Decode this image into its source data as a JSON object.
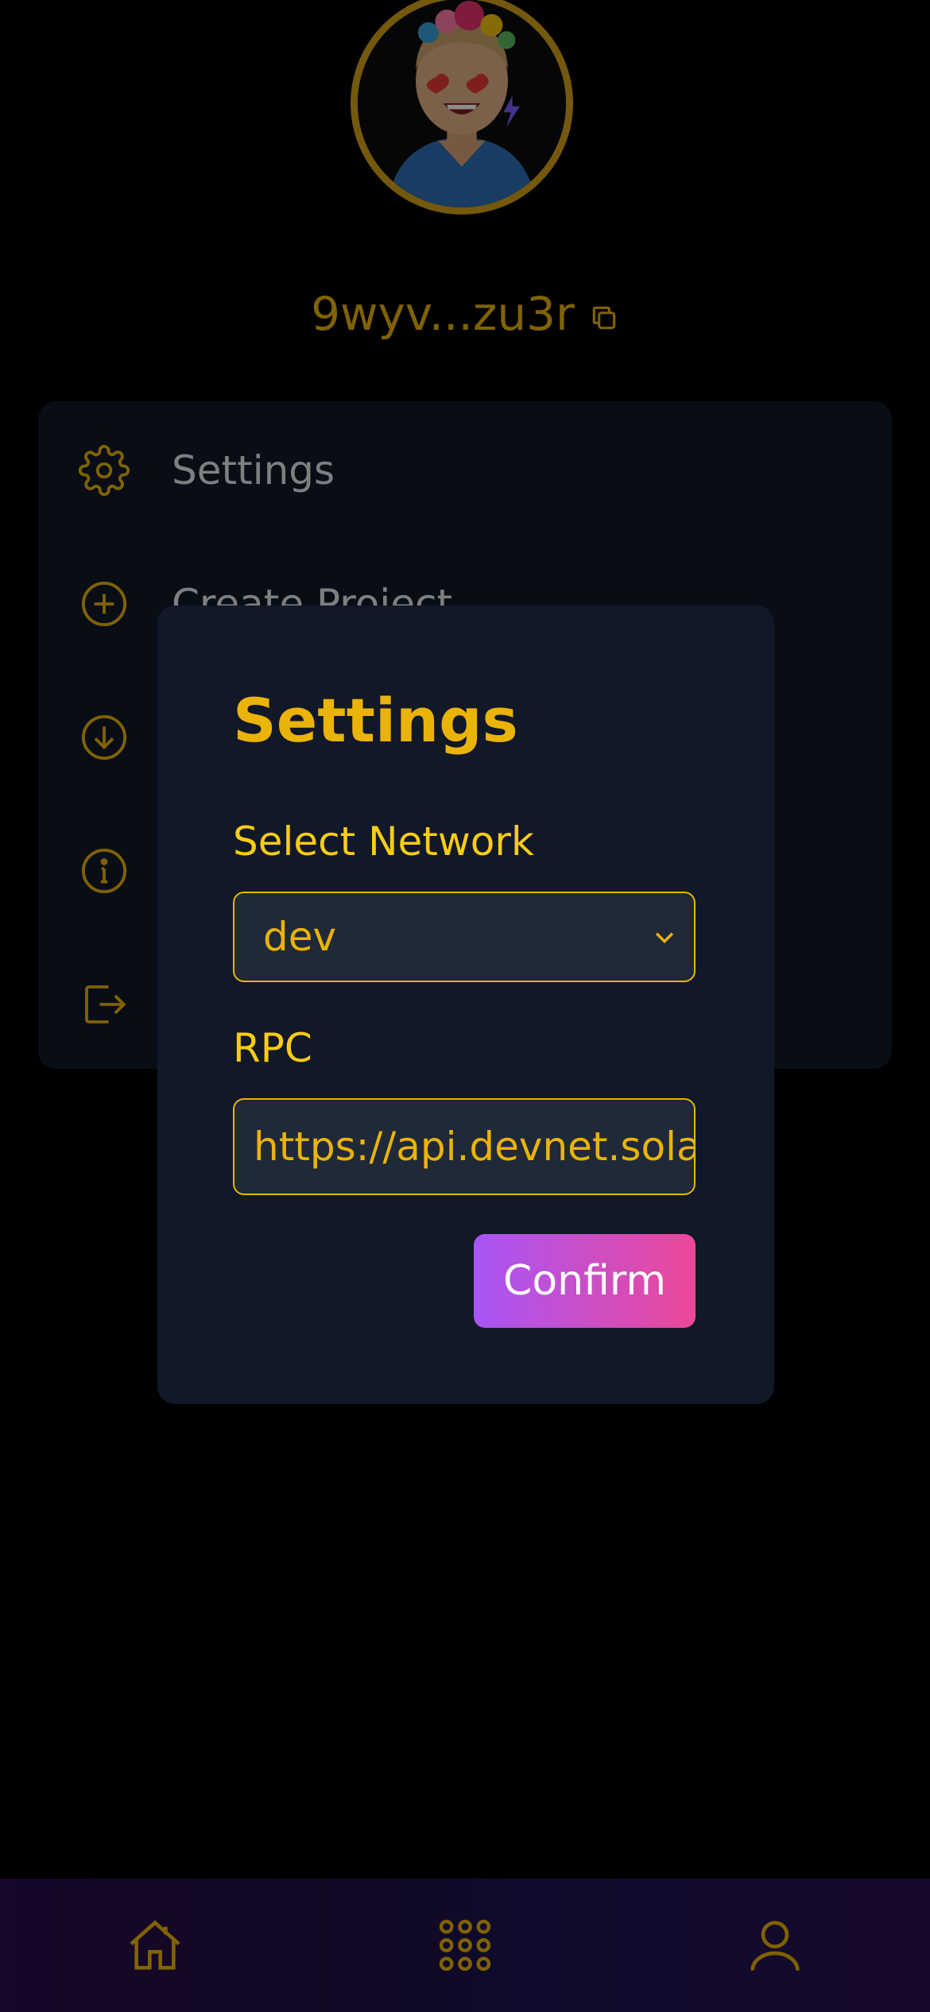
{
  "profile": {
    "address": "9wyv...zu3r"
  },
  "menu": {
    "items": [
      {
        "label": "Settings",
        "icon": "gear-icon"
      },
      {
        "label": "Create Project",
        "icon": "plus-circle-icon"
      },
      {
        "label": "",
        "icon": "download-circle-icon"
      },
      {
        "label": "",
        "icon": "info-circle-icon"
      },
      {
        "label": "",
        "icon": "logout-icon"
      }
    ]
  },
  "modal": {
    "title": "Settings",
    "network_label": "Select Network",
    "network_value": "dev",
    "rpc_label": "RPC",
    "rpc_value": "https://api.devnet.solar",
    "confirm_label": "Confirm"
  },
  "nav": {
    "items": [
      "home-icon",
      "apps-grid-icon",
      "profile-icon"
    ]
  },
  "colors": {
    "accent": "#eab308",
    "card": "#111827",
    "input_bg": "#1f2937",
    "button_gradient_start": "#a855f7",
    "button_gradient_end": "#ec4899"
  }
}
